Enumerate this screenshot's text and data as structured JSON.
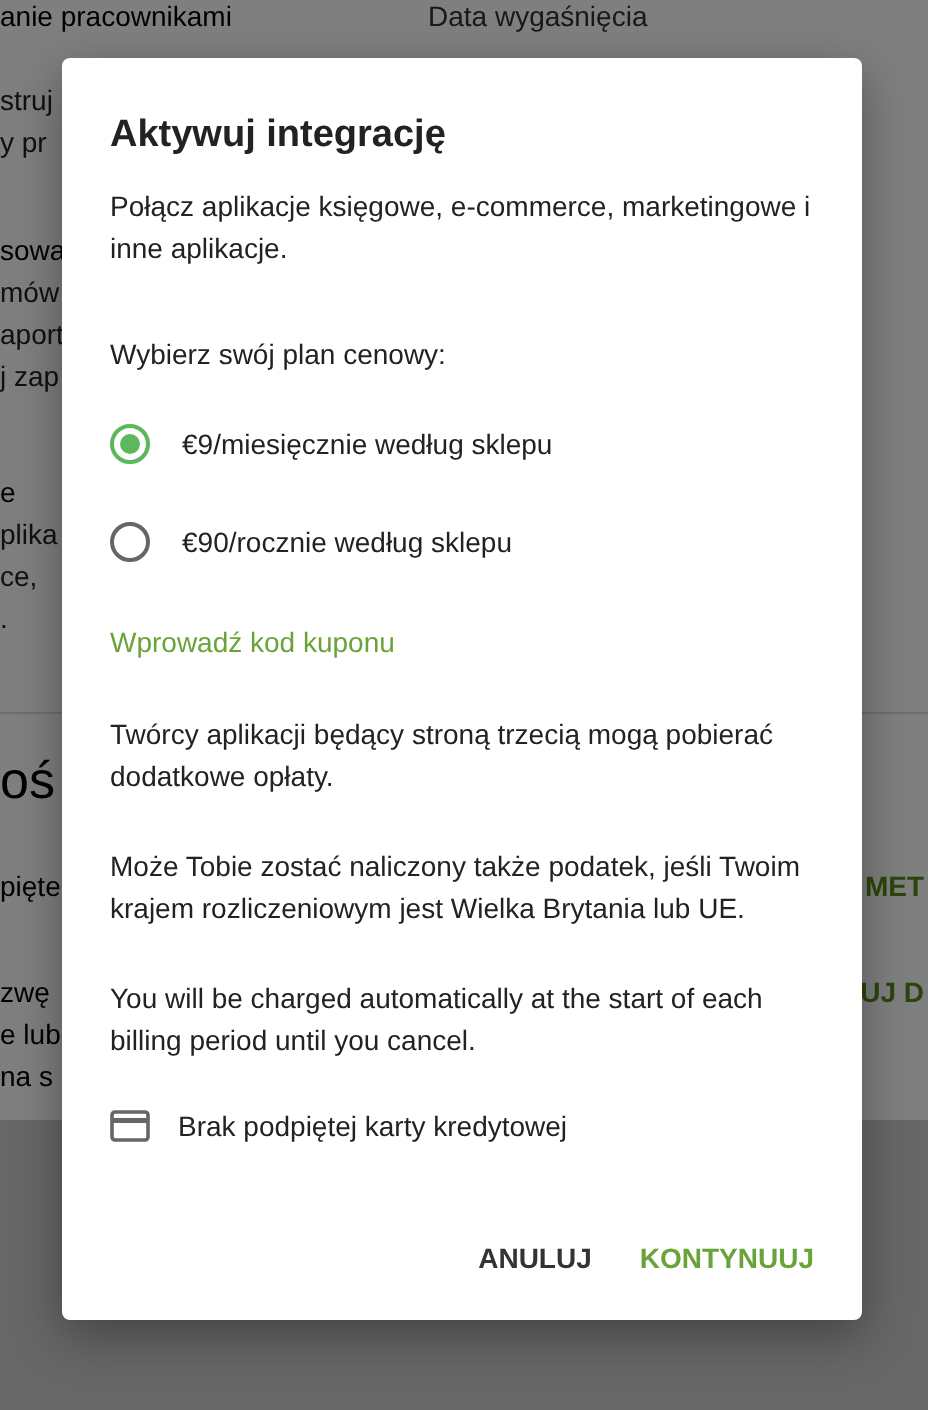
{
  "background": {
    "left_column": [
      {
        "text": "anie pracownikami",
        "kind": "heading"
      },
      {
        "text": "struj",
        "kind": "body"
      },
      {
        "text": "y pr",
        "kind": "body"
      },
      {
        "text": "sowa",
        "kind": "heading"
      },
      {
        "text": "mów",
        "kind": "body"
      },
      {
        "text": "aport",
        "kind": "body"
      },
      {
        "text": "j zap",
        "kind": "body"
      },
      {
        "text": "e",
        "kind": "heading"
      },
      {
        "text": "plika",
        "kind": "body"
      },
      {
        "text": "ce,",
        "kind": "body"
      },
      {
        "text": ".",
        "kind": "body"
      }
    ],
    "right_column": [
      "Data wygaśnięcia"
    ],
    "section_title": "oś",
    "section_rows": [
      {
        "text": "pięte",
        "action": "MET"
      },
      {
        "text": "zwę",
        "action": "UJ D"
      },
      {
        "text": "e lub"
      },
      {
        "text": "na s"
      }
    ]
  },
  "dialog": {
    "title": "Aktywuj integrację",
    "intro": "Połącz aplikacje księgowe, e-commerce, marketingowe i inne aplikacje.",
    "plan_prompt": "Wybierz swój plan cenowy:",
    "plans": [
      {
        "label": "€9/miesięcznie według sklepu",
        "selected": true
      },
      {
        "label": "€90/rocznie według sklepu",
        "selected": false
      }
    ],
    "coupon_link": "Wprowadź kod kuponu",
    "notes": [
      "Twórcy aplikacji będący stroną trzecią mogą pobierać dodatkowe opłaty.",
      "Może Tobie zostać naliczony także podatek, jeśli Twoim krajem rozliczeniowym jest Wielka Brytania lub UE.",
      "You will be charged automatically at the start of each billing period until you cancel."
    ],
    "card_status": "Brak podpiętej karty kredytowej",
    "buttons": [
      {
        "label": "ANULUJ",
        "kind": "secondary"
      },
      {
        "label": "KONTYNUUJ",
        "kind": "primary"
      }
    ]
  }
}
